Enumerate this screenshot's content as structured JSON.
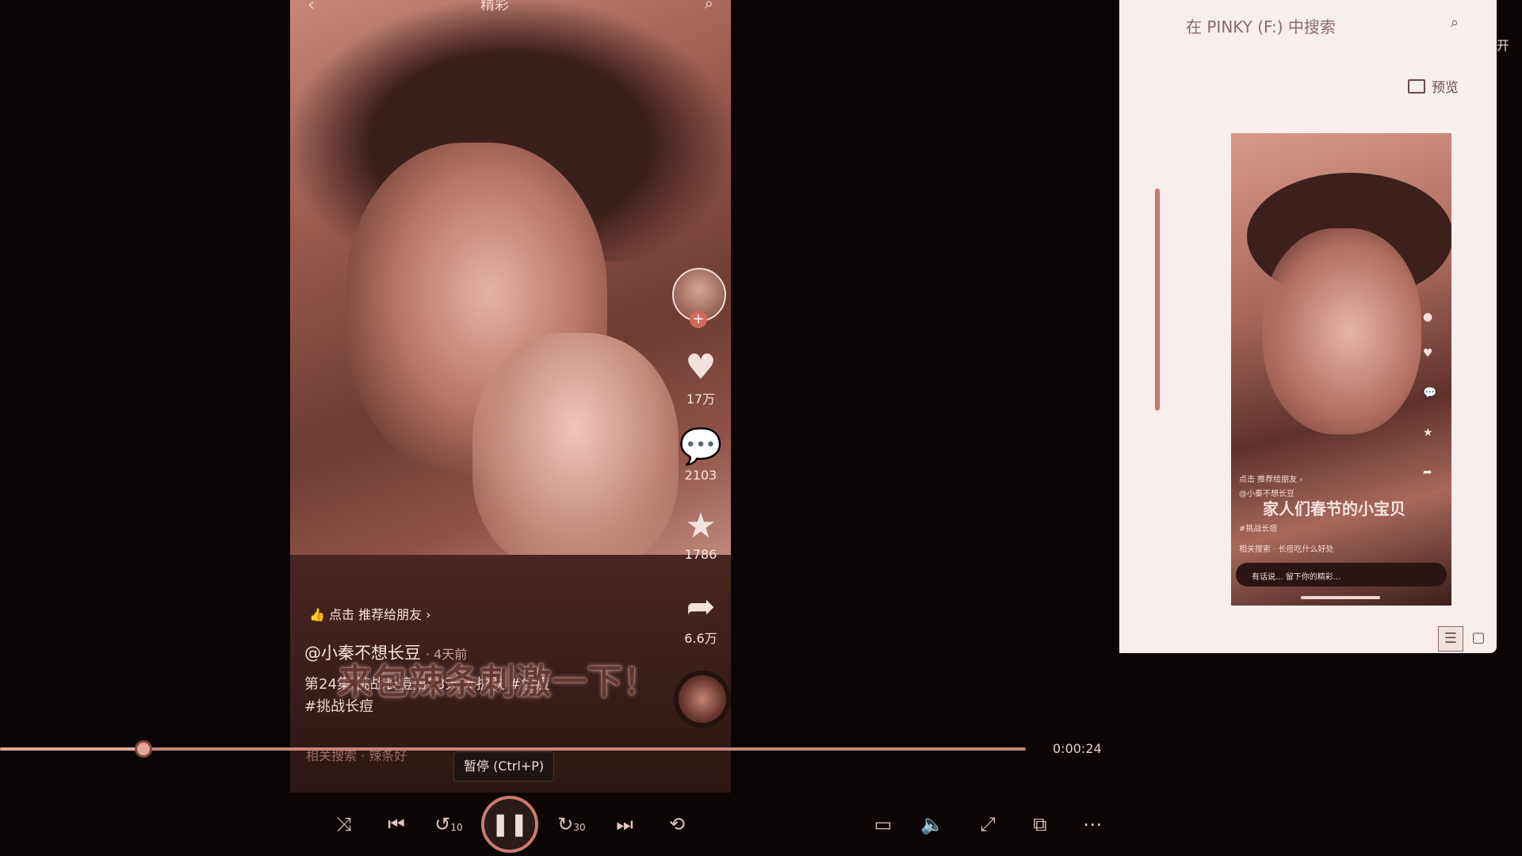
{
  "video": {
    "top_back_icon": "chevron-left-icon",
    "top_title": "精彩",
    "top_search_icon": "search-icon",
    "recommend": "👍 点击 推荐给朋友 ›",
    "author": "@小秦不想长豆",
    "time_ago": "· 4天前",
    "description": "第24集 挑战长痘第23天 #护肤 #痘痘",
    "description_line2": "#挑战长痘",
    "subtitle": "来包辣条刺激一下！",
    "related": "相关搜索 · 辣条好",
    "likes": "17万",
    "comments": "2103",
    "favorites": "1786",
    "shares": "6.6万"
  },
  "player": {
    "time": "0:00:24",
    "progress": 0.14,
    "tooltip": "暂停 (Ctrl+P)",
    "skip_back": "10",
    "skip_forward": "30"
  },
  "explorer": {
    "search_placeholder": "在 PINKY (F:) 中搜索",
    "open_label": "开",
    "preview_label": "预览",
    "thumb_subtitle": "家人们春节的小宝贝",
    "thumb_line1": "点击 推荐给朋友 ›",
    "thumb_line2": "@小秦不想长豆",
    "thumb_line3": "#挑战长痘",
    "thumb_search": "相关搜索 · 长痘吃什么好处",
    "thumb_input": "有话说... 留下你的精彩..."
  }
}
